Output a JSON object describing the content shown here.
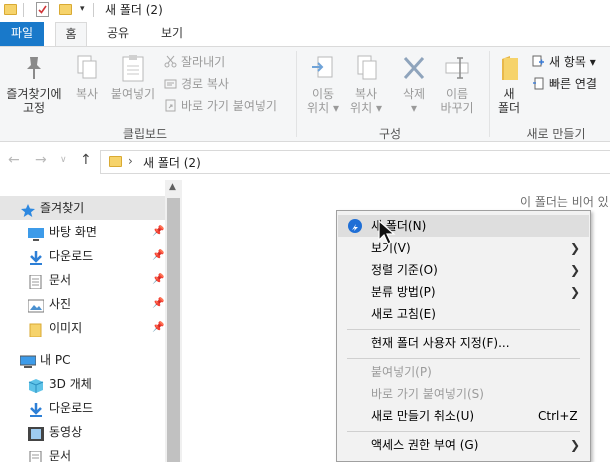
{
  "window": {
    "title": "새 폴더 (2)"
  },
  "tabs": [
    {
      "label": "파일"
    },
    {
      "label": "홈"
    },
    {
      "label": "공유"
    },
    {
      "label": "보기"
    }
  ],
  "ribbon": {
    "clipboard": {
      "pin_label_1": "즐겨찾기에",
      "pin_label_2": "고정",
      "copy": "복사",
      "paste": "붙여넣기",
      "cut": "잘라내기",
      "copy_path": "경로 복사",
      "paste_shortcut": "바로 가기 붙여넣기",
      "group": "클립보드"
    },
    "organize": {
      "move_1": "이동",
      "move_2": "위치",
      "copy_1": "복사",
      "copy_2": "위치",
      "delete": "삭제",
      "rename_1": "이름",
      "rename_2": "바꾸기",
      "group": "구성"
    },
    "new": {
      "folder_1": "새",
      "folder_2": "폴더",
      "new_item": "새 항목",
      "easy_access": "빠른 연결",
      "group": "새로 만들기"
    }
  },
  "address": {
    "path": "새 폴더 (2)"
  },
  "nav": {
    "quick_access": "즐겨찾기",
    "items": [
      {
        "label": "바탕 화면"
      },
      {
        "label": "다운로드"
      },
      {
        "label": "문서"
      },
      {
        "label": "사진"
      },
      {
        "label": "이미지"
      }
    ],
    "this_pc": "내 PC",
    "pc_items": [
      {
        "label": "3D 개체"
      },
      {
        "label": "다운로드"
      },
      {
        "label": "동영상"
      },
      {
        "label": "문서"
      }
    ]
  },
  "content": {
    "empty_message": "이 폴더는 비어 있"
  },
  "context_menu": {
    "new_folder": "새 폴더(N)",
    "view": "보기(V)",
    "sort_by": "정렬 기준(O)",
    "group_by": "분류 방법(P)",
    "refresh": "새로 고침(E)",
    "customize": "현재 폴더 사용자 지정(F)...",
    "paste": "붙여넣기(P)",
    "paste_shortcut": "바로 가기 붙여넣기(S)",
    "undo_new": "새로 만들기 취소(U)",
    "undo_shortcut": "Ctrl+Z",
    "give_access": "액세스 권한 부여 (G)"
  }
}
